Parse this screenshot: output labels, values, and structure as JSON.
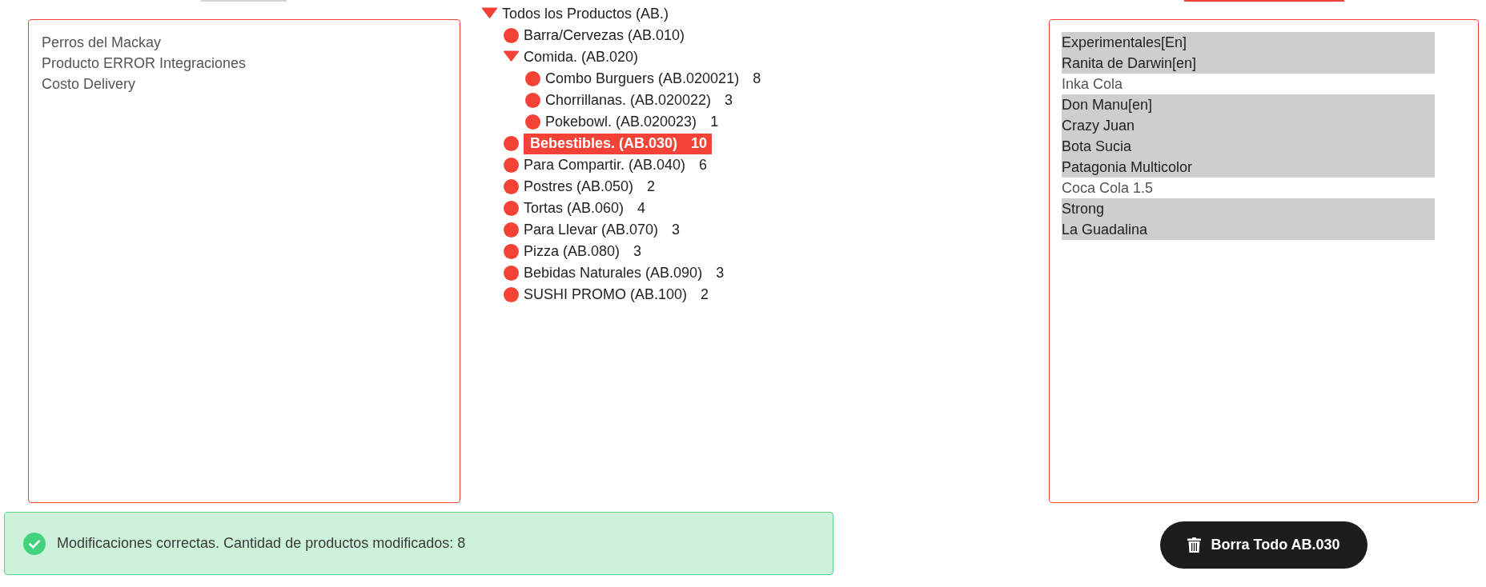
{
  "left_list": {
    "items": [
      {
        "label": "Perros del Mackay",
        "selected": false
      },
      {
        "label": "Producto ERROR Integraciones",
        "selected": false
      },
      {
        "label": "Costo Delivery",
        "selected": false
      }
    ]
  },
  "tree": {
    "label": "Todos los Productos (AB.)",
    "expanded": true,
    "selected": false,
    "children": [
      {
        "label": "Barra/Cervezas (AB.010)",
        "selected": false
      },
      {
        "label": "Comida. (AB.020)",
        "expanded": true,
        "selected": false,
        "children": [
          {
            "label": "Combo Burguers (AB.020021)",
            "count": "8",
            "selected": false
          },
          {
            "label": "Chorrillanas. (AB.020022)",
            "count": "3",
            "selected": false
          },
          {
            "label": "Pokebowl. (AB.020023)",
            "count": "1",
            "selected": false
          }
        ]
      },
      {
        "label": "Bebestibles. (AB.030)",
        "count": "10",
        "selected": true
      },
      {
        "label": "Para Compartir. (AB.040)",
        "count": "6",
        "selected": false
      },
      {
        "label": "Postres (AB.050)",
        "count": "2",
        "selected": false
      },
      {
        "label": "Tortas (AB.060)",
        "count": "4",
        "selected": false
      },
      {
        "label": "Para Llevar (AB.070)",
        "count": "3",
        "selected": false
      },
      {
        "label": "Pizza (AB.080)",
        "count": "3",
        "selected": false
      },
      {
        "label": "Bebidas Naturales (AB.090)",
        "count": "3",
        "selected": false
      },
      {
        "label": "SUSHI PROMO (AB.100)",
        "count": "2",
        "selected": false
      }
    ]
  },
  "right_list": {
    "items": [
      {
        "label": "Experimentales[En]",
        "selected": true
      },
      {
        "label": "Ranita de Darwin[en]",
        "selected": true
      },
      {
        "label": "Inka Cola",
        "selected": false
      },
      {
        "label": "Don Manu[en]",
        "selected": true
      },
      {
        "label": "Crazy Juan",
        "selected": true
      },
      {
        "label": "Bota Sucia",
        "selected": true
      },
      {
        "label": "Patagonia Multicolor",
        "selected": true
      },
      {
        "label": "Coca Cola 1.5",
        "selected": false
      },
      {
        "label": "Strong",
        "selected": true
      },
      {
        "label": "La Guadalina",
        "selected": true
      }
    ]
  },
  "alert": {
    "message": "Modificaciones correctas. Cantidad de productos modificados: 8"
  },
  "delete_button": {
    "label": "Borra Todo AB.030"
  }
}
